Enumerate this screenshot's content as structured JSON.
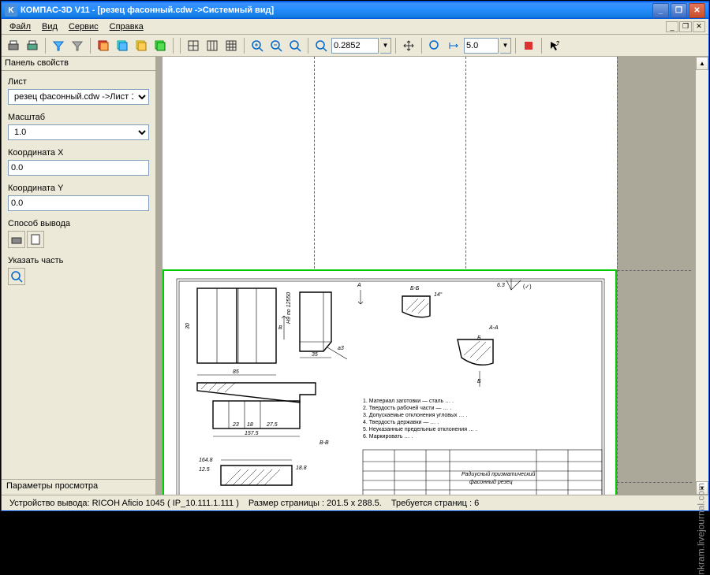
{
  "title": "КОМПАС-3D V11 - [резец фасонный.cdw ->Системный вид]",
  "menu": {
    "file": "Файл",
    "view": "Вид",
    "service": "Сервис",
    "help": "Справка"
  },
  "toolbar": {
    "zoom": "0.2852",
    "step": "5.0"
  },
  "sidebar": {
    "title": "Панель свойств",
    "list_label": "Лист",
    "list_value": "резец фасонный.cdw ->Лист 1",
    "scale_label": "Масштаб",
    "scale_value": "1.0",
    "coord_x_label": "Координата X",
    "coord_x_value": "0.0",
    "coord_y_label": "Координата Y",
    "coord_y_value": "0.0",
    "output_label": "Способ вывода",
    "specify_label": "Указать часть",
    "tab": "Параметры просмотра"
  },
  "drawing": {
    "marks": {
      "A": "А",
      "B": "В",
      "B_B": "Б-Б",
      "A_A": "А-А",
      "B_dash_B": "В-В",
      "arrow_B": "Б"
    },
    "dims": {
      "d35": "35",
      "d85": "85",
      "d30": "30",
      "d23": "23",
      "d18": "18",
      "d275": "27.5",
      "d1575": "157.5",
      "d1648": "164.8",
      "d125": "12.5",
      "d188": "18.8",
      "a14": "14°",
      "a3": "a3",
      "r63": "6.3"
    },
    "notes": [
      "1. Материал заготовки — сталь … .",
      "2. Твердость рабочей части — … .",
      "3. Допускаемые отклонения угловых … .",
      "4. Твердость державки — … .",
      "5. Неуказанные предельные отклонения … .",
      "6. Маркировать … ."
    ],
    "titleblock": {
      "name1": "Радиусный призматический",
      "name2": "фасонный резец"
    }
  },
  "status": {
    "device": "Устройство вывода: RICOH Aficio 1045 ( IP_10.111.1.111 )",
    "pagesize": "Размер страницы : 201.5 x 288.5.",
    "pages": "Требуется страниц : 6"
  },
  "watermark": "nkram.livejournal.com"
}
